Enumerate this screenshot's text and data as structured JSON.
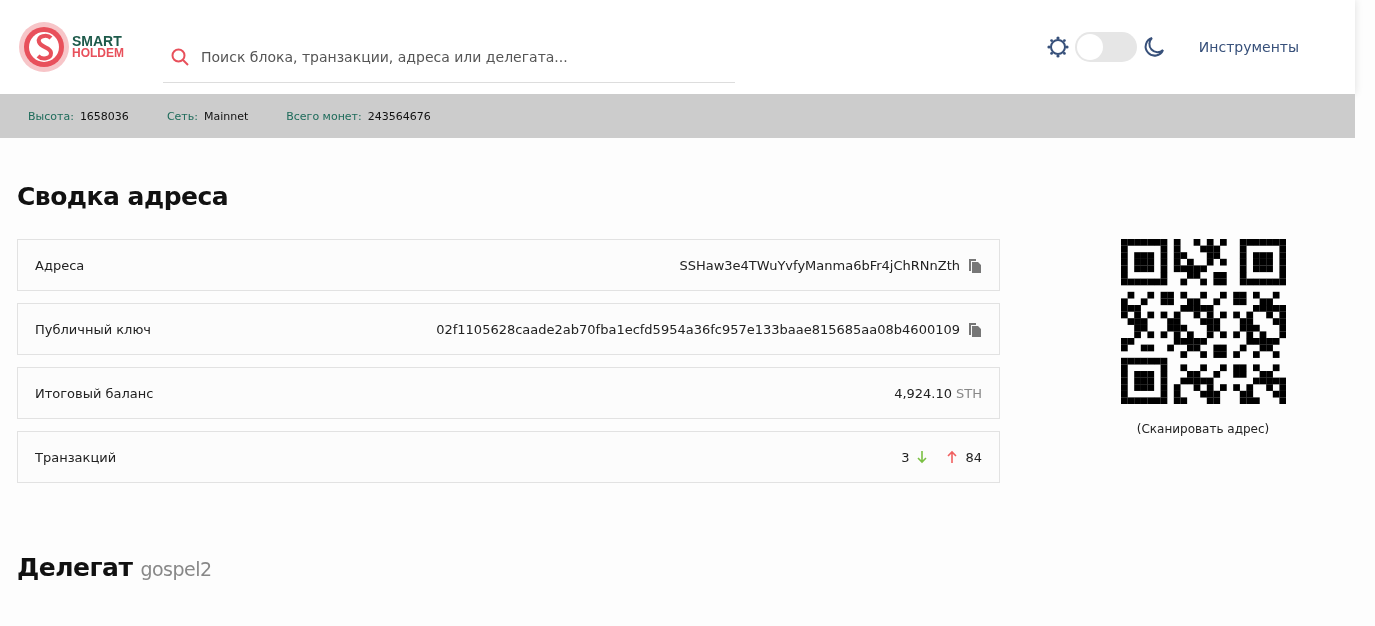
{
  "header": {
    "logo": {
      "line1": "SMART",
      "line2": "HOLDEM"
    },
    "search": {
      "placeholder": "Поиск блока, транзакции, адреса или делегата..."
    },
    "theme_toggle": {
      "on": false
    },
    "tools_link": "Инструменты"
  },
  "stats": [
    {
      "label": "Высота:",
      "value": "1658036"
    },
    {
      "label": "Сеть:",
      "value": "Mainnet"
    },
    {
      "label": "Всего монет:",
      "value": "243564676"
    }
  ],
  "summary": {
    "title": "Сводка адреса",
    "rows": [
      {
        "kind": "copy",
        "label": "Адреса",
        "value": "SSHaw3e4TWuYvfyManma6bFr4jChRNnZth"
      },
      {
        "kind": "copy",
        "label": "Публичный ключ",
        "value": "02f1105628caade2ab70fba1ecfd5954a36fc957e133baae815685aa08b4600109"
      },
      {
        "kind": "balance",
        "label": "Итоговый баланс",
        "value": "4,924.10",
        "unit": "STH"
      },
      {
        "kind": "transactions",
        "label": "Транзакций",
        "received": "3",
        "sent": "84"
      }
    ],
    "qr_caption": "(Сканировать адрес)"
  },
  "delegate": {
    "title": "Делегат",
    "name": "gospel2"
  }
}
